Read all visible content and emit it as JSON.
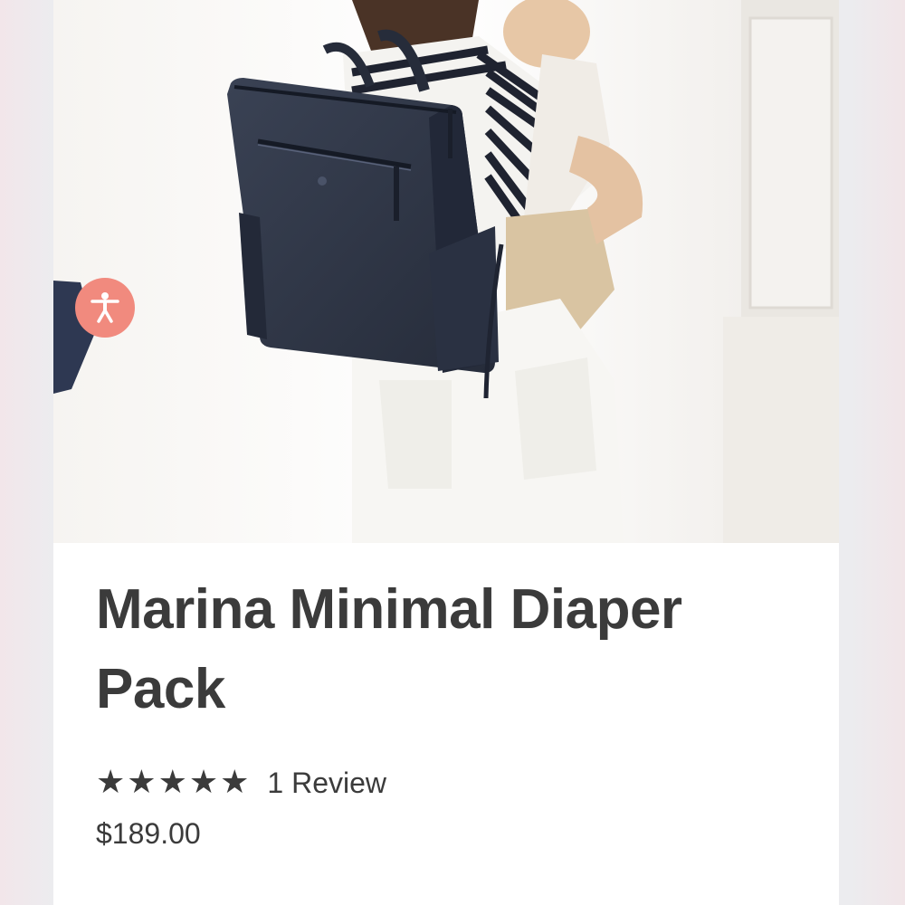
{
  "product": {
    "title": "Marina Minimal Diaper Pack",
    "image_alt": "Woman wearing navy backpack holding toddler",
    "rating": 5,
    "rating_max": 5,
    "review_count_label": "1 Review",
    "price": "$189.00"
  },
  "accessibility_button": {
    "icon": "accessibility-person-icon",
    "color": "#f18a7e"
  },
  "colors": {
    "text": "#3b3b3b",
    "bag": "#2e3545"
  }
}
